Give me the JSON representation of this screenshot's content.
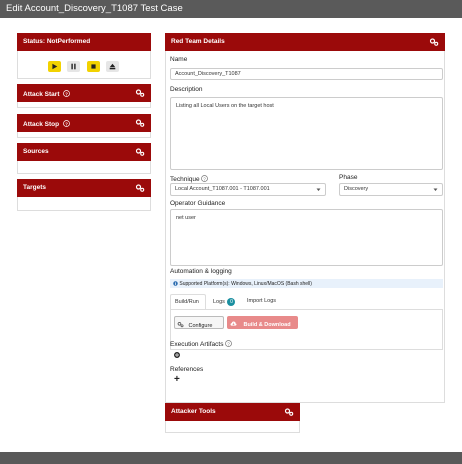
{
  "window": {
    "title": "Edit Account_Discovery_T1087 Test Case"
  },
  "status": {
    "label": "Status: NotPerformed"
  },
  "left_panels": [
    {
      "title": "Attack Start",
      "icon": "help-icon"
    },
    {
      "title": "Attack Stop",
      "icon": "help-icon"
    },
    {
      "title": "Sources"
    },
    {
      "title": "Targets"
    }
  ],
  "red_team": {
    "title": "Red Team Details",
    "name_label": "Name",
    "name_value": "Account_Discovery_T1087",
    "description_label": "Description",
    "description_value": "Listing all Local Users on the target host",
    "technique_label": "Technique",
    "technique_value": "Local Account_T1087.001 - T1087.001",
    "phase_label": "Phase",
    "phase_value": "Discovery",
    "guidance_label": "Operator Guidance",
    "guidance_value": "net user",
    "automation_label": "Automation & logging",
    "platform_note": "Supported Platform(s): Windows, Linux/MacOS (Bash shell)",
    "tabs": [
      "Build/Run",
      "Logs",
      "Import Logs"
    ],
    "logs_badge": "0",
    "configure_label": "Configure",
    "build_label": "Build & Download",
    "artifacts_label": "Execution Artifacts",
    "references_label": "References",
    "add_symbol": "+"
  },
  "attacker_tools": {
    "title": "Attacker Tools"
  },
  "colors": {
    "header": "#9b0a0a",
    "accent_yellow": "#f2d200",
    "build_button": "#e88a8a",
    "info_bg": "#e8f1fb"
  }
}
